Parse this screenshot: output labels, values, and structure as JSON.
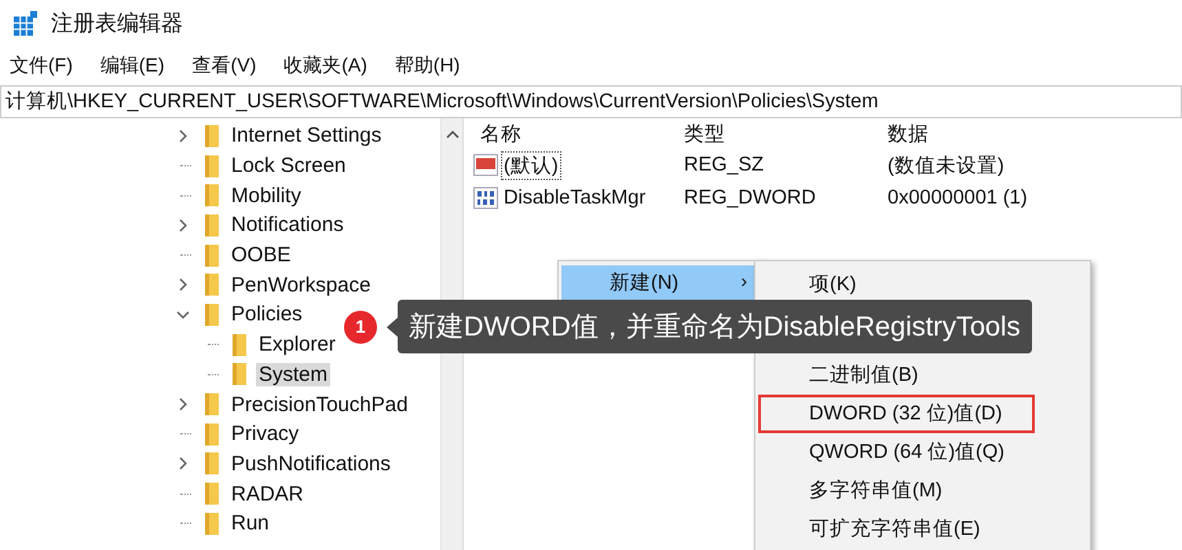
{
  "window": {
    "title": "注册表编辑器"
  },
  "menu_bar": [
    "文件(F)",
    "编辑(E)",
    "查看(V)",
    "收藏夹(A)",
    "帮助(H)"
  ],
  "address_bar": {
    "value": "计算机\\HKEY_CURRENT_USER\\SOFTWARE\\Microsoft\\Windows\\CurrentVersion\\Policies\\System"
  },
  "tree": [
    {
      "label": "Internet Settings",
      "kind": "expandable",
      "expanded": false,
      "selected": false
    },
    {
      "label": "Lock Screen",
      "kind": "leaf",
      "selected": false
    },
    {
      "label": "Mobility",
      "kind": "leaf",
      "selected": false
    },
    {
      "label": "Notifications",
      "kind": "expandable",
      "expanded": false,
      "selected": false
    },
    {
      "label": "OOBE",
      "kind": "leaf",
      "selected": false
    },
    {
      "label": "PenWorkspace",
      "kind": "expandable",
      "expanded": false,
      "selected": false
    },
    {
      "label": "Policies",
      "kind": "expandable",
      "expanded": true,
      "selected": false,
      "children": [
        {
          "label": "Explorer",
          "kind": "leaf",
          "selected": false
        },
        {
          "label": "System",
          "kind": "leaf",
          "selected": true
        }
      ]
    },
    {
      "label": "PrecisionTouchPad",
      "kind": "expandable",
      "expanded": false,
      "selected": false
    },
    {
      "label": "Privacy",
      "kind": "leaf",
      "selected": false
    },
    {
      "label": "PushNotifications",
      "kind": "expandable",
      "expanded": false,
      "selected": false
    },
    {
      "label": "RADAR",
      "kind": "leaf",
      "selected": false
    },
    {
      "label": "Run",
      "kind": "leaf",
      "selected": false
    }
  ],
  "values_table": {
    "columns": [
      "名称",
      "类型",
      "数据"
    ],
    "rows": [
      {
        "name": "(默认)",
        "type": "REG_SZ",
        "data": "(数值未设置)",
        "kind": "string",
        "focused": true
      },
      {
        "name": "DisableTaskMgr",
        "type": "REG_DWORD",
        "data": "0x00000001 (1)",
        "kind": "binary",
        "focused": false
      }
    ]
  },
  "context_menu": {
    "items": [
      {
        "label": "新建(N)",
        "arrow": "›",
        "selected": true
      }
    ]
  },
  "submenu": {
    "items": [
      {
        "label": "项(K)",
        "highlighted": false
      },
      {
        "label": "二进制值(B)",
        "highlighted": false
      },
      {
        "label": "DWORD (32 位)值(D)",
        "highlighted": true
      },
      {
        "label": "QWORD (64 位)值(Q)",
        "highlighted": false
      },
      {
        "label": "多字符串值(M)",
        "highlighted": false
      },
      {
        "label": "可扩充字符串值(E)",
        "highlighted": false
      }
    ]
  },
  "callout": {
    "step": "1",
    "text": "新建DWORD值，并重命名为DisableRegistryTools"
  }
}
